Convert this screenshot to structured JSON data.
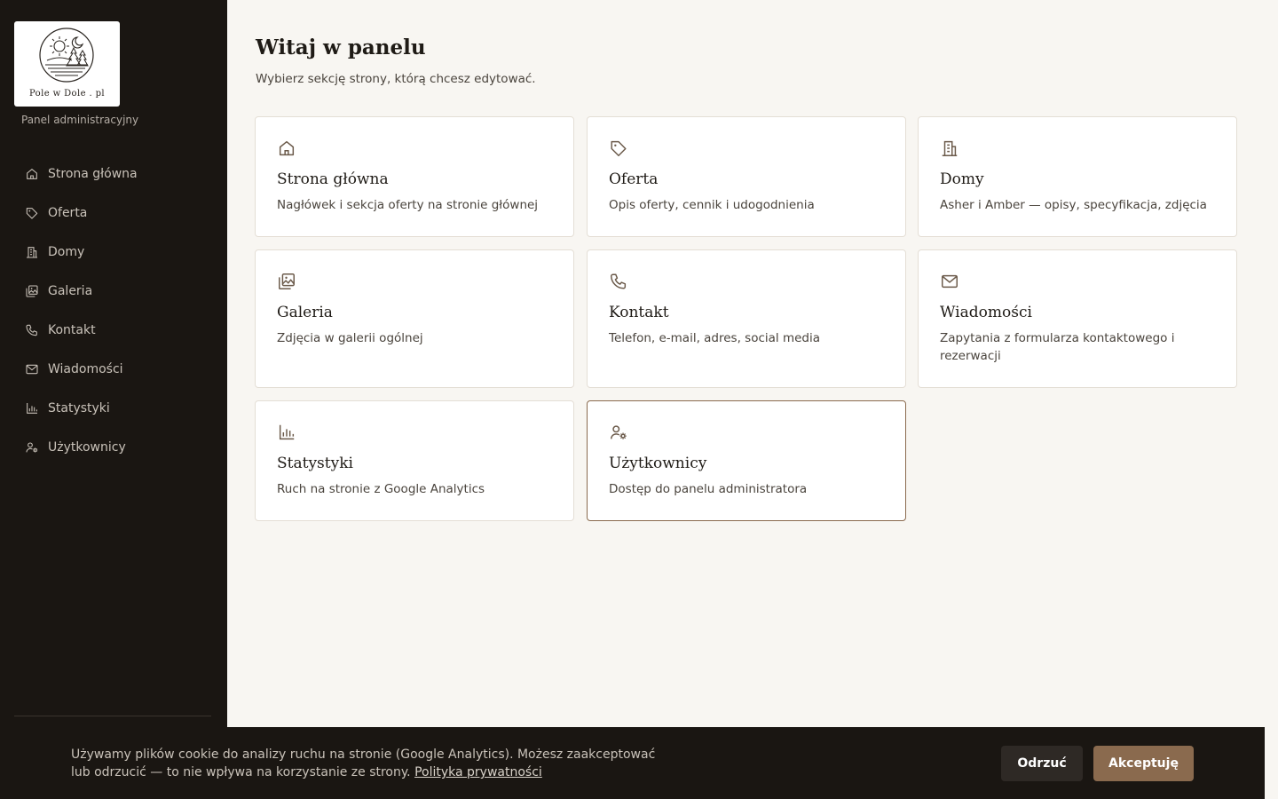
{
  "sidebar": {
    "logo_text": "Pole w Dole . pl",
    "panel_label": "Panel administracyjny",
    "items": [
      {
        "label": "Strona główna",
        "icon": "home-icon"
      },
      {
        "label": "Oferta",
        "icon": "tag-icon"
      },
      {
        "label": "Domy",
        "icon": "building-icon"
      },
      {
        "label": "Galeria",
        "icon": "gallery-icon"
      },
      {
        "label": "Kontakt",
        "icon": "phone-icon"
      },
      {
        "label": "Wiadomości",
        "icon": "mail-icon"
      },
      {
        "label": "Statystyki",
        "icon": "bar-chart-icon"
      },
      {
        "label": "Użytkownicy",
        "icon": "user-settings-icon"
      }
    ]
  },
  "main": {
    "title": "Witaj w panelu",
    "subtitle": "Wybierz sekcję strony, którą chcesz edytować.",
    "cards": [
      {
        "title": "Strona główna",
        "description": "Nagłówek i sekcja oferty na stronie głównej",
        "icon": "home-icon"
      },
      {
        "title": "Oferta",
        "description": "Opis oferty, cennik i udogodnienia",
        "icon": "tag-icon"
      },
      {
        "title": "Domy",
        "description": "Asher i Amber — opisy, specyfikacja, zdjęcia",
        "icon": "building-icon"
      },
      {
        "title": "Galeria",
        "description": "Zdjęcia w galerii ogólnej",
        "icon": "gallery-icon"
      },
      {
        "title": "Kontakt",
        "description": "Telefon, e-mail, adres, social media",
        "icon": "phone-icon"
      },
      {
        "title": "Wiadomości",
        "description": "Zapytania z formularza kontaktowego i rezerwacji",
        "icon": "mail-icon"
      },
      {
        "title": "Statystyki",
        "description": "Ruch na stronie z Google Analytics",
        "icon": "bar-chart-icon"
      },
      {
        "title": "Użytkownicy",
        "description": "Dostęp do panelu administratora",
        "icon": "user-settings-icon"
      }
    ]
  },
  "cookie": {
    "text": "Używamy plików cookie do analizy ruchu na stronie (Google Analytics). Możesz zaakceptować lub odrzucić — to nie wpływa na korzystanie ze strony. ",
    "link_label": "Polityka prywatności",
    "reject_label": "Odrzuć",
    "accept_label": "Akceptuję"
  },
  "colors": {
    "sidebar_bg": "#1a1612",
    "page_bg": "#f8f6f2",
    "accent": "#8a6a4e",
    "nav_text": "#c9c2b9"
  }
}
